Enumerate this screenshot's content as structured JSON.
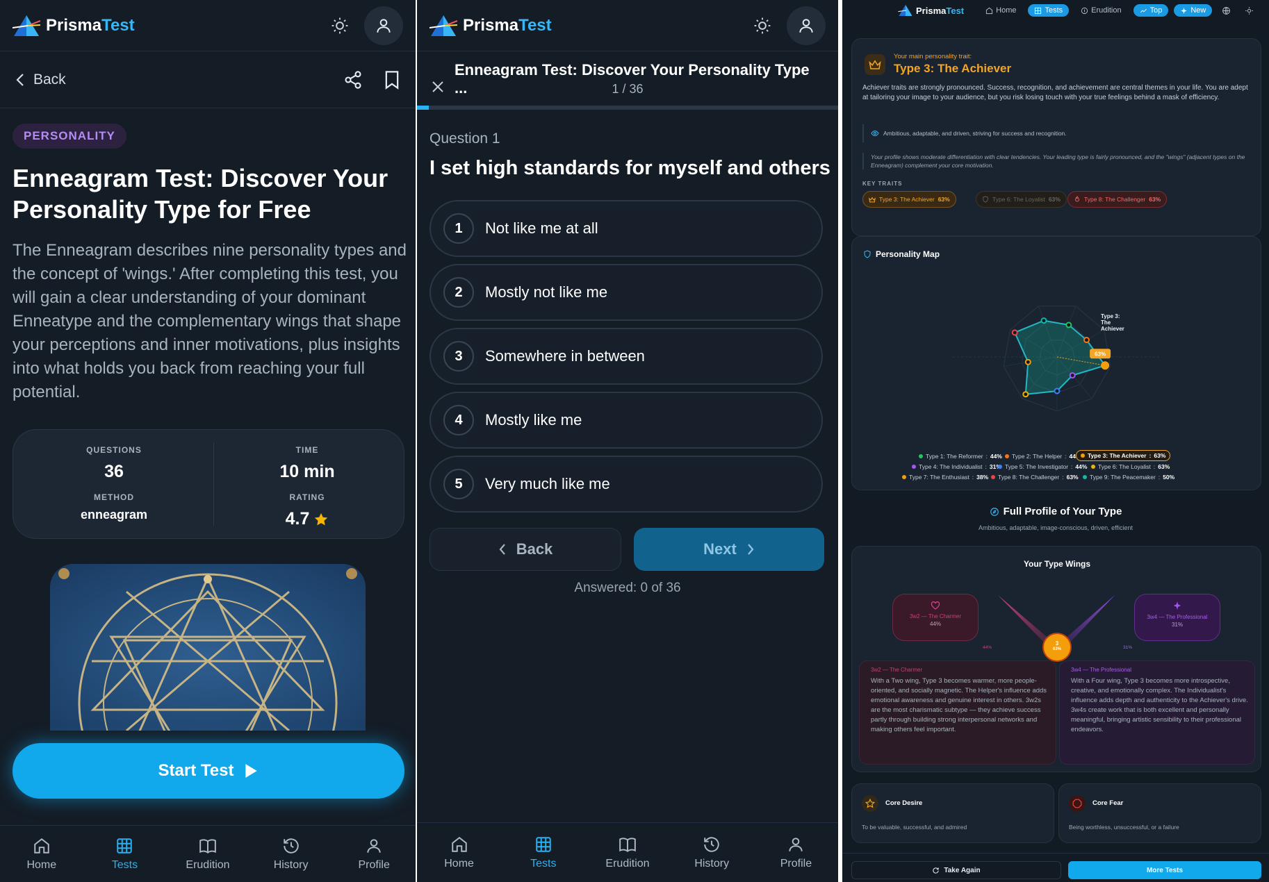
{
  "brand": {
    "name_part1": "Prisma",
    "name_part2": "Test"
  },
  "detail": {
    "back_label": "Back",
    "category_badge": "PERSONALITY",
    "title": "Enneagram Test: Discover Your Personality Type for Free",
    "description": "The Enneagram describes nine personality types and the concept of 'wings.' After completing this test, you will gain a clear understanding of your dominant Enneatype and the complementary wings that shape your perceptions and inner motivations, plus insights into what holds you back from reaching your full potential.",
    "stats": {
      "questions_label": "QUESTIONS",
      "questions_value": "36",
      "time_label": "TIME",
      "time_value": "10 min",
      "method_label": "METHOD",
      "method_value": "enneagram",
      "rating_label": "RATING",
      "rating_value": "4.7"
    },
    "start_label": "Start Test"
  },
  "quiz": {
    "title": "Enneagram Test: Discover Your Personality Type ...",
    "counter": "1 / 36",
    "progress_fraction": 0.0278,
    "question_number": "Question 1",
    "question_text": "I set high standards for myself and others",
    "options": [
      {
        "num": "1",
        "label": "Not like me at all"
      },
      {
        "num": "2",
        "label": "Mostly not like me"
      },
      {
        "num": "3",
        "label": "Somewhere in between"
      },
      {
        "num": "4",
        "label": "Mostly like me"
      },
      {
        "num": "5",
        "label": "Very much like me"
      }
    ],
    "back_label": "Back",
    "next_label": "Next",
    "answered": "Answered: 0 of 36"
  },
  "bottom_nav": [
    {
      "label": "Home",
      "icon": "home-icon"
    },
    {
      "label": "Tests",
      "icon": "grid-icon",
      "active": true
    },
    {
      "label": "Erudition",
      "icon": "book-icon"
    },
    {
      "label": "History",
      "icon": "history-icon"
    },
    {
      "label": "Profile",
      "icon": "user-icon"
    }
  ],
  "result": {
    "topnav": {
      "home": "Home",
      "tests": "Tests",
      "erudition": "Erudition",
      "top": "Top",
      "new": "New"
    },
    "main_label": "Your main personality trait:",
    "main_type": "Type 3: The Achiever",
    "main_desc": "Achiever traits are strongly pronounced. Success, recognition, and achievement are central themes in your life. You are adept at tailoring your image to your audience, but you risk losing touch with your true feelings behind a mask of efficiency.",
    "summary_line": "Ambitious, adaptable, and driven, striving for success and recognition.",
    "profile_note": "Your profile shows moderate differentiation with clear tendencies. Your leading type is fairly pronounced, and the \"wings\" (adjacent types on the Enneagram) complement your core motivation.",
    "key_traits_label": "KEY TRAITS",
    "key_traits": [
      {
        "label": "Type 3: The Achiever",
        "value": "63%"
      },
      {
        "label": "Type 6: The Loyalist",
        "value": "63%"
      },
      {
        "label": "Type 8: The Challenger",
        "value": "63%"
      }
    ],
    "map_title": "Personality Map",
    "map_highlight_value": "63%",
    "map_highlight_label": "Type 3: The Achiever",
    "chart_data": {
      "type": "radar",
      "categories": [
        "Type 1: The Reformer",
        "Type 2: The Helper",
        "Type 3: The Achiever",
        "Type 4: The Individualist",
        "Type 5: The Investigator",
        "Type 6: The Loyalist",
        "Type 7: The Enthusiast",
        "Type 8: The Challenger",
        "Type 9: The Peacemaker"
      ],
      "values": [
        44,
        44,
        63,
        31,
        44,
        63,
        38,
        63,
        50
      ],
      "value_labels": [
        "44%",
        "44%",
        "63%",
        "31%",
        "44%",
        "63%",
        "38%",
        "63%",
        "50%"
      ],
      "colors": [
        "#22c55e",
        "#f97316",
        "#f59e0b",
        "#a855f7",
        "#3b82f6",
        "#eab308",
        "#f59e0b",
        "#ef4444",
        "#14b8a6"
      ]
    },
    "full_profile_title": "Full Profile of Your Type",
    "full_profile_sub": "Ambitious, adaptable, image-conscious, driven, efficient",
    "wings_title": "Your Type Wings",
    "wing_left": {
      "name": "3w2 — The Charmer",
      "value": "44%",
      "text": "With a Two wing, Type 3 becomes warmer, more people-oriented, and socially magnetic. The Helper's influence adds emotional awareness and genuine interest in others. 3w2s are the most charismatic subtype — they achieve success partly through building strong interpersonal networks and making others feel important."
    },
    "wing_right": {
      "name": "3w4 — The Professional",
      "value": "31%",
      "text": "With a Four wing, Type 3 becomes more introspective, creative, and emotionally complex. The Individualist's influence adds depth and authenticity to the Achiever's drive. 3w4s create work that is both excellent and personally meaningful, bringing artistic sensibility to their professional endeavors."
    },
    "center_badge": "3",
    "center_value": "63%",
    "core_desire_title": "Core Desire",
    "core_desire_text": "To be valuable, successful, and admired",
    "core_fear_title": "Core Fear",
    "core_fear_text": "Being worthless, unsuccessful, or a failure",
    "take_again": "Take Again",
    "more_tests": "More Tests"
  },
  "colors": {
    "accent": "#11a8ec",
    "bg": "#141c26",
    "achiever": "#f5a524",
    "badge_purple": "#b48cf3"
  }
}
